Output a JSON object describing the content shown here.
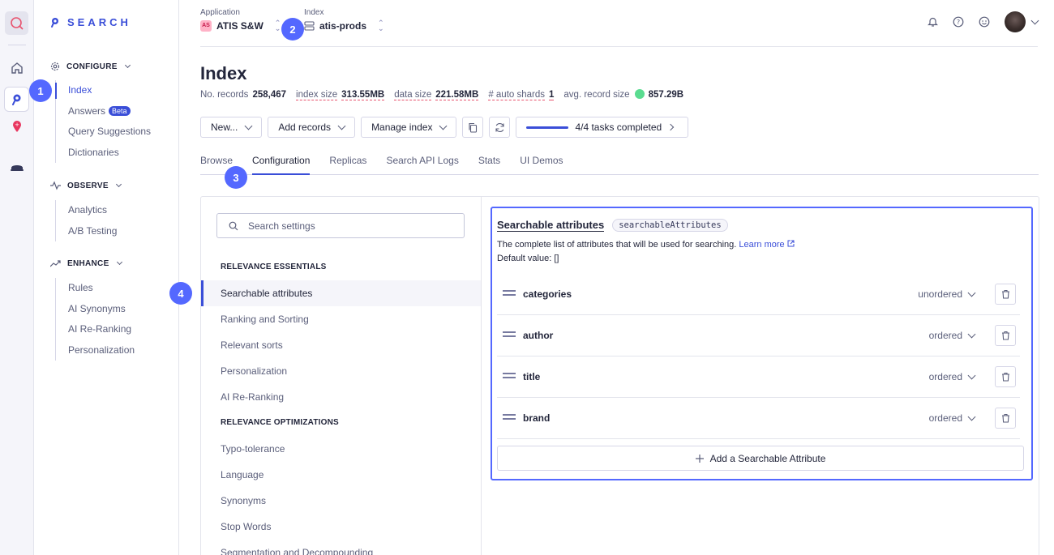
{
  "brand": {
    "name": "SEARCH"
  },
  "sidebar": {
    "sections": [
      {
        "title": "CONFIGURE",
        "items": [
          "Index",
          "Answers",
          "Query Suggestions",
          "Dictionaries"
        ],
        "badge": "Beta"
      },
      {
        "title": "OBSERVE",
        "items": [
          "Analytics",
          "A/B Testing"
        ]
      },
      {
        "title": "ENHANCE",
        "items": [
          "Rules",
          "AI Synonyms",
          "AI Re-Ranking",
          "Personalization"
        ]
      }
    ]
  },
  "header": {
    "application_label": "Application",
    "application_badge": "AS",
    "application_value": "ATIS S&W",
    "index_label": "Index",
    "index_value": "atis-prods"
  },
  "page": {
    "title": "Index",
    "stats": {
      "records_label": "No. records",
      "records_value": "258,467",
      "index_size_label": "index size",
      "index_size_value": "313.55MB",
      "data_size_label": "data size",
      "data_size_value": "221.58MB",
      "shards_label": "# auto shards",
      "shards_value": "1",
      "avg_label": "avg. record size",
      "avg_value": "857.29B"
    },
    "actions": {
      "new": "New...",
      "add_records": "Add records",
      "manage_index": "Manage index",
      "tasks": "4/4 tasks completed"
    },
    "tabs": [
      "Browse",
      "Configuration",
      "Replicas",
      "Search API Logs",
      "Stats",
      "UI Demos"
    ]
  },
  "settings": {
    "search_placeholder": "Search settings",
    "group1": "RELEVANCE ESSENTIALS",
    "group1_items": [
      "Searchable attributes",
      "Ranking and Sorting",
      "Relevant sorts",
      "Personalization",
      "AI Re-Ranking"
    ],
    "group2": "RELEVANCE OPTIMIZATIONS",
    "group2_items": [
      "Typo-tolerance",
      "Language",
      "Synonyms",
      "Stop Words",
      "Segmentation and Decompounding"
    ]
  },
  "detail": {
    "title": "Searchable attributes",
    "code": "searchableAttributes",
    "description": "The complete list of attributes that will be used for searching.",
    "learn_more": "Learn more",
    "default_value": "Default value: []",
    "attributes": [
      {
        "name": "categories",
        "order": "unordered"
      },
      {
        "name": "author",
        "order": "ordered"
      },
      {
        "name": "title",
        "order": "ordered"
      },
      {
        "name": "brand",
        "order": "ordered"
      }
    ],
    "add_label": "Add a Searchable Attribute"
  },
  "steps": [
    "1",
    "2",
    "3",
    "4"
  ],
  "colors": {
    "accent": "#5468ff",
    "link": "#3a4ed8",
    "success": "#5adc90"
  }
}
